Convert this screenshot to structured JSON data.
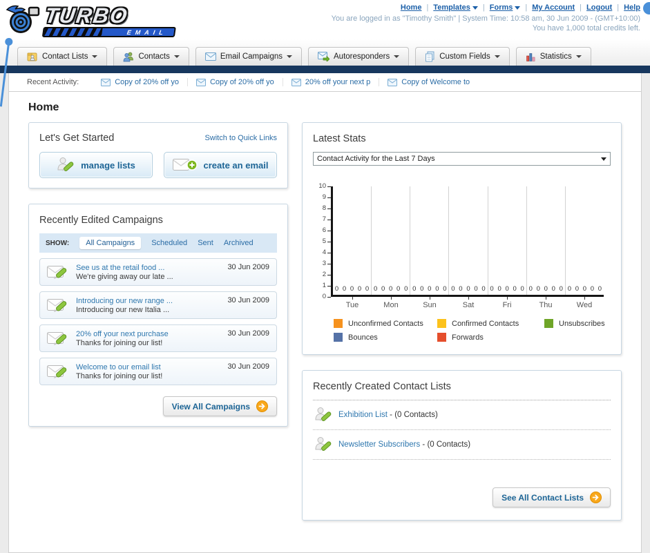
{
  "logo": {
    "title": "TURBO",
    "subtitle": "EMAIL"
  },
  "header": {
    "nav_links": [
      {
        "label": "Home",
        "dropdown": false
      },
      {
        "label": "Templates",
        "dropdown": true
      },
      {
        "label": "Forms",
        "dropdown": true
      },
      {
        "label": "My Account",
        "dropdown": false
      },
      {
        "label": "Logout",
        "dropdown": false
      },
      {
        "label": "Help",
        "dropdown": false
      }
    ],
    "login_line": "You are logged in as \"Timothy Smith\" | System Time: 10:58 am, 30 Jun 2009 - (GMT+10:00)",
    "credits_line": "You have 1,000 total credits left."
  },
  "nav": {
    "tabs": [
      {
        "label": "Contact Lists",
        "icon": "contact-lists-icon"
      },
      {
        "label": "Contacts",
        "icon": "contacts-icon"
      },
      {
        "label": "Email Campaigns",
        "icon": "email-campaigns-icon"
      },
      {
        "label": "Autoresponders",
        "icon": "autoresponders-icon"
      },
      {
        "label": "Custom Fields",
        "icon": "custom-fields-icon"
      },
      {
        "label": "Statistics",
        "icon": "statistics-icon"
      }
    ]
  },
  "recent_activity": {
    "label": "Recent Activity:",
    "items": [
      "Copy of 20% off yo",
      "Copy of 20% off yo",
      "20% off your next p",
      "Copy of Welcome to"
    ]
  },
  "page_title": "Home",
  "get_started": {
    "title": "Let's Get Started",
    "switch_link": "Switch to Quick Links",
    "manage_lists_label": "manage lists",
    "create_email_label": "create an email"
  },
  "campaigns": {
    "title": "Recently Edited Campaigns",
    "show_label": "SHOW:",
    "filters": [
      "All Campaigns",
      "Scheduled",
      "Sent",
      "Archived"
    ],
    "active_filter": "All Campaigns",
    "rows": [
      {
        "title": "See us at the retail food ...",
        "subtitle": "We're giving away our late ...",
        "date": "30 Jun 2009"
      },
      {
        "title": "Introducing our new range ...",
        "subtitle": "Introducing our new Italia ...",
        "date": "30 Jun 2009"
      },
      {
        "title": "20% off your next purchase",
        "subtitle": "Thanks for joining our list!",
        "date": "30 Jun 2009"
      },
      {
        "title": "Welcome to our email list",
        "subtitle": "Thanks for joining our list!",
        "date": "30 Jun 2009"
      }
    ],
    "view_all_label": "View All Campaigns"
  },
  "stats": {
    "title": "Latest Stats",
    "dropdown_value": "Contact Activity for the Last 7 Days"
  },
  "chart_data": {
    "type": "bar",
    "categories": [
      "Tue",
      "Mon",
      "Sun",
      "Sat",
      "Fri",
      "Thu",
      "Wed"
    ],
    "series": [
      {
        "name": "Unconfirmed Contacts",
        "color": "#f6921e",
        "values": [
          0,
          0,
          0,
          0,
          0,
          0,
          0
        ]
      },
      {
        "name": "Confirmed Contacts",
        "color": "#fcc21c",
        "values": [
          0,
          0,
          0,
          0,
          0,
          0,
          0
        ]
      },
      {
        "name": "Unsubscribes",
        "color": "#6fa528",
        "values": [
          0,
          0,
          0,
          0,
          0,
          0,
          0
        ]
      },
      {
        "name": "Bounces",
        "color": "#5572a7",
        "values": [
          0,
          0,
          0,
          0,
          0,
          0,
          0
        ]
      },
      {
        "name": "Forwards",
        "color": "#e54e2c",
        "values": [
          0,
          0,
          0,
          0,
          0,
          0,
          0
        ]
      }
    ],
    "title": "Contact Activity for the Last 7 Days",
    "xlabel": "",
    "ylabel": "",
    "ylim": [
      0,
      10
    ],
    "ytick_step": 1,
    "grid": "vertical-only",
    "legend_position": "bottom",
    "value_labels_shown": true
  },
  "contact_lists": {
    "title": "Recently Created Contact Lists",
    "items": [
      {
        "name": "Exhibition List",
        "suffix": " - (0 Contacts)"
      },
      {
        "name": "Newsletter Subscribers",
        "suffix": " - (0 Contacts)"
      }
    ],
    "see_all_label": "See All Contact Lists"
  }
}
